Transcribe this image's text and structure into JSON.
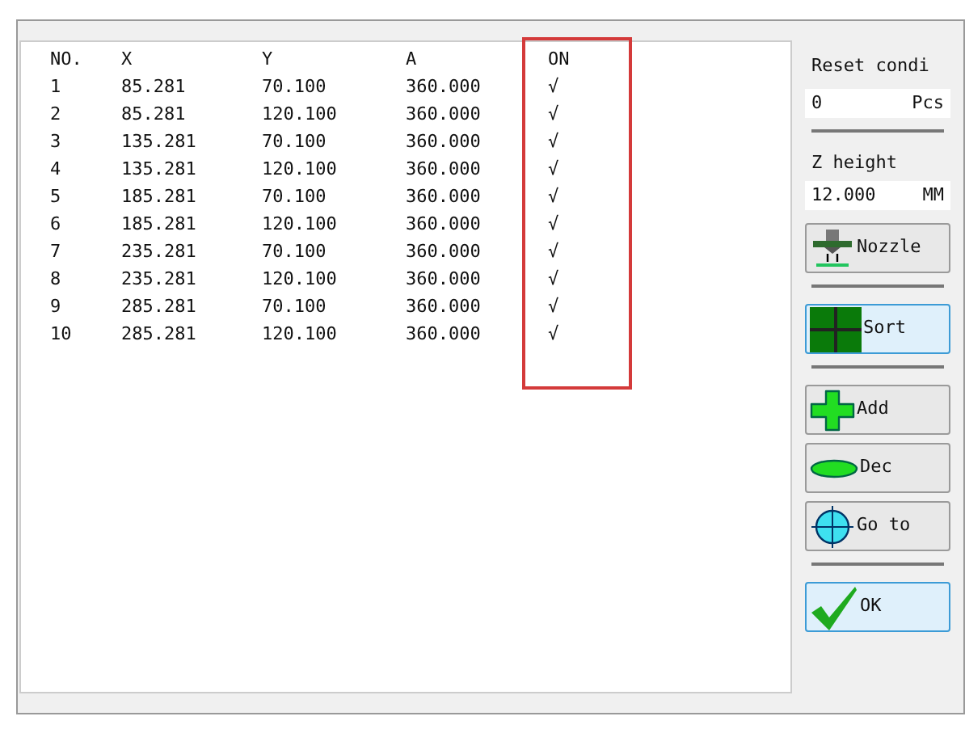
{
  "table": {
    "columns": [
      {
        "label": "NO.",
        "highlighted": false
      },
      {
        "label": "X",
        "highlighted": false
      },
      {
        "label": "Y",
        "highlighted": false
      },
      {
        "label": "A",
        "highlighted": false
      },
      {
        "label": "ON",
        "highlighted": true
      }
    ],
    "rows": [
      [
        "1",
        "85.281",
        "70.100",
        "360.000",
        "√"
      ],
      [
        "2",
        "85.281",
        "120.100",
        "360.000",
        "√"
      ],
      [
        "3",
        "135.281",
        "70.100",
        "360.000",
        "√"
      ],
      [
        "4",
        "135.281",
        "120.100",
        "360.000",
        "√"
      ],
      [
        "5",
        "185.281",
        "70.100",
        "360.000",
        "√"
      ],
      [
        "6",
        "185.281",
        "120.100",
        "360.000",
        "√"
      ],
      [
        "7",
        "235.281",
        "70.100",
        "360.000",
        "√"
      ],
      [
        "8",
        "235.281",
        "120.100",
        "360.000",
        "√"
      ],
      [
        "9",
        "285.281",
        "70.100",
        "360.000",
        "√"
      ],
      [
        "10",
        "285.281",
        "120.100",
        "360.000",
        "√"
      ]
    ]
  },
  "reset": {
    "label": "Reset condi",
    "value": "0",
    "unit": "Pcs"
  },
  "z_height": {
    "label": "Z height",
    "value": "12.000",
    "unit": "MM"
  },
  "button_groups": [
    [
      {
        "kind": "nozzle",
        "label": "Nozzle",
        "selected": false
      }
    ],
    [
      {
        "kind": "sort",
        "label": "Sort",
        "selected": true
      }
    ],
    [
      {
        "kind": "add",
        "label": "Add",
        "selected": false
      },
      {
        "kind": "dec",
        "label": "Dec",
        "selected": false
      },
      {
        "kind": "goto",
        "label": "Go to",
        "selected": false
      }
    ],
    [
      {
        "kind": "ok",
        "label": "OK",
        "selected": true
      }
    ]
  ]
}
